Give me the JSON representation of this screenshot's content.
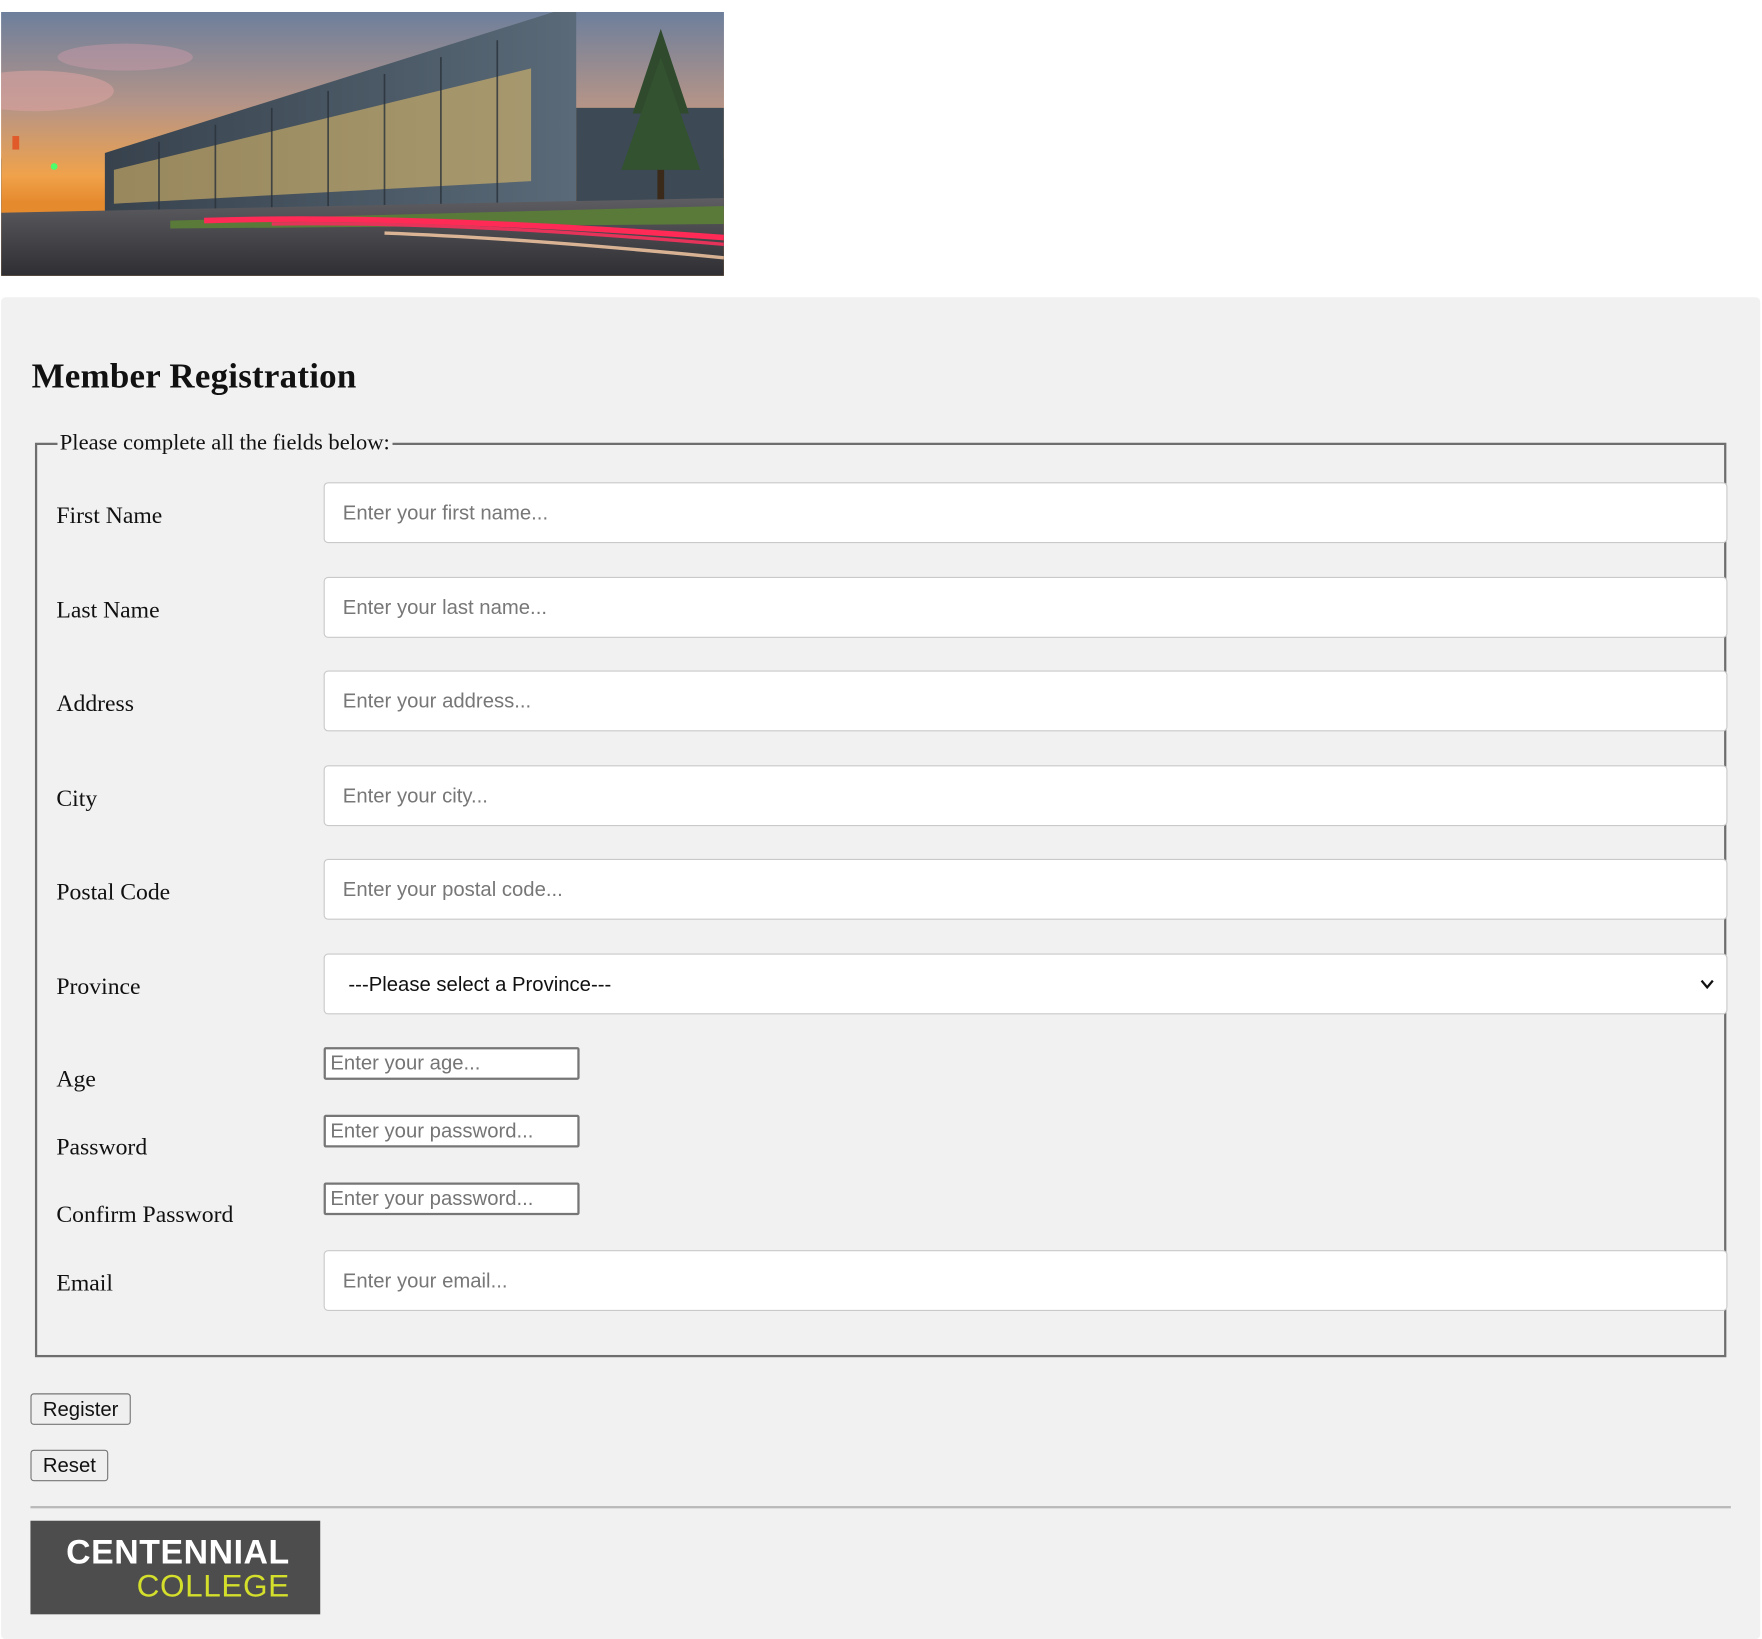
{
  "header": {
    "banner_alt": "Centennial College campus building at sunset"
  },
  "form": {
    "title": "Member Registration",
    "legend": "Please complete all the fields below:",
    "fields": {
      "first_name": {
        "label": "First Name",
        "placeholder": "Enter your first name...",
        "value": ""
      },
      "last_name": {
        "label": "Last Name",
        "placeholder": "Enter your last name...",
        "value": ""
      },
      "address": {
        "label": "Address",
        "placeholder": "Enter your address...",
        "value": ""
      },
      "city": {
        "label": "City",
        "placeholder": "Enter your city...",
        "value": ""
      },
      "postal_code": {
        "label": "Postal Code",
        "placeholder": "Enter your postal code...",
        "value": ""
      },
      "province": {
        "label": "Province",
        "selected": "---Please select a Province---"
      },
      "age": {
        "label": "Age",
        "placeholder": "Enter your age...",
        "value": ""
      },
      "password": {
        "label": "Password",
        "placeholder": "Enter your password...",
        "value": ""
      },
      "confirm_password": {
        "label": "Confirm Password",
        "placeholder": "Enter your password...",
        "value": ""
      },
      "email": {
        "label": "Email",
        "placeholder": "Enter your email...",
        "value": ""
      }
    },
    "buttons": {
      "register": "Register",
      "reset": "Reset"
    }
  },
  "footer": {
    "logo_line1": "CENTENNIAL",
    "logo_line2": "COLLEGE",
    "logo_accent": "#d4df2c"
  },
  "colors": {
    "panel_bg": "#f1f1f1",
    "logo_bg": "#4d4d4d"
  }
}
